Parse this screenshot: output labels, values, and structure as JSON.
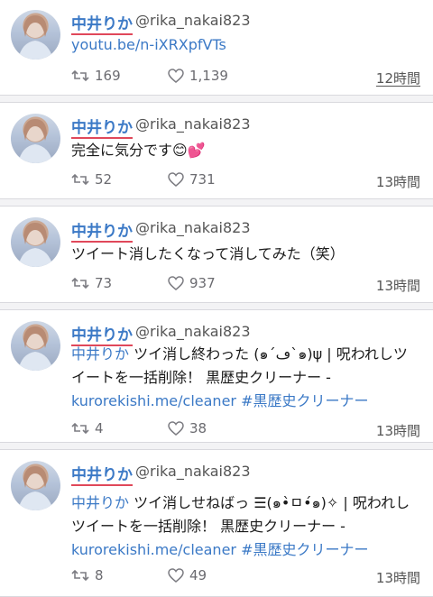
{
  "tweets": [
    {
      "name": "中井りか",
      "handle": "@rika_nakai823",
      "text_link": "youtu.be/n-iXRXpfVTs",
      "retweets": "169",
      "likes": "1,139",
      "time": "12時間"
    },
    {
      "name": "中井りか",
      "handle": "@rika_nakai823",
      "text": "完全に気分です😊💕",
      "retweets": "52",
      "likes": "731",
      "time": "13時間"
    },
    {
      "name": "中井りか",
      "handle": "@rika_nakai823",
      "text": "ツイート消したくなって消してみた（笑）",
      "retweets": "73",
      "likes": "937",
      "time": "13時間"
    },
    {
      "name": "中井りか",
      "handle": "@rika_nakai823",
      "text_mention": "中井りか",
      "text_rest": " ツイ消し終わった (๑´ڡ`๑)ψ | 呪われしツイートを一括削除！ 黒歴史クリーナー -",
      "text_link": "kurorekishi.me/cleaner",
      "text_hashtag": "#黒歴史クリーナー",
      "retweets": "4",
      "likes": "38",
      "time": "13時間"
    },
    {
      "name": "中井りか",
      "handle": "@rika_nakai823",
      "text_mention": "中井りか",
      "text_rest": " ツイ消しせねばっ ☰(๑•̀ㅁ•́๑)✧ | 呪われしツイートを一括削除！ 黒歴史クリーナー -",
      "text_link": "kurorekishi.me/cleaner",
      "text_hashtag": "#黒歴史クリーナー",
      "retweets": "8",
      "likes": "49",
      "time": "13時間"
    }
  ]
}
